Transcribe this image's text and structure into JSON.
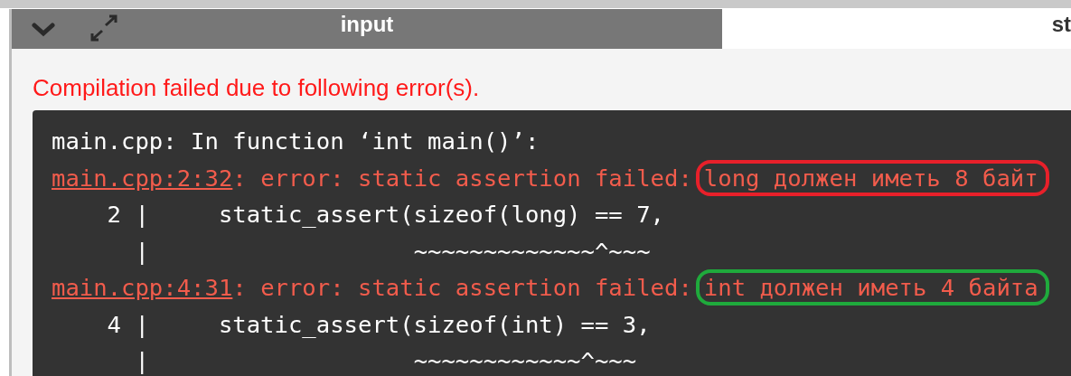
{
  "tabs": [
    {
      "label": "input",
      "selected": false
    },
    {
      "label": "st",
      "selected": true
    }
  ],
  "message": "Compilation failed due to following error(s).",
  "output_lines": [
    {
      "kind": "plain",
      "text": "main.cpp: In function ‘int main()’:"
    },
    {
      "kind": "error",
      "location": "main.cpp:2:32",
      "text": ": error: static assertion failed:",
      "note": "long должен иметь 8 байт",
      "color": "#e8202a"
    },
    {
      "kind": "source",
      "line_no": "2",
      "gutter": "|",
      "code": "static_assert(sizeof(long) == 7,"
    },
    {
      "kind": "caret",
      "gutter": "|",
      "marker": "~~~~~~~~~~~~~^~~~"
    },
    {
      "kind": "error",
      "location": "main.cpp:4:31",
      "text": ": error: static assertion failed:",
      "note": "int должен иметь 4 байта",
      "color": "#1faa3c"
    },
    {
      "kind": "source",
      "line_no": "4",
      "gutter": "|",
      "code": "static_assert(sizeof(int) == 3,"
    },
    {
      "kind": "caret",
      "gutter": "|",
      "marker": "~~~~~~~~~~~~^~~~"
    }
  ]
}
